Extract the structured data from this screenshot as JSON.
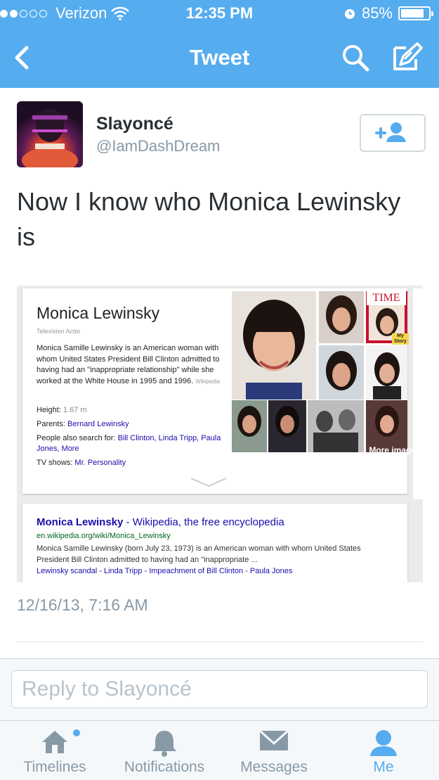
{
  "status_bar": {
    "carrier": "Verizon",
    "signal_bars": 2,
    "signal_max": 5,
    "time": "12:35 PM",
    "battery": "85%",
    "battery_level": 0.85
  },
  "nav": {
    "title": "Tweet"
  },
  "tweet": {
    "display_name": "Slayoncé",
    "handle": "@IamDashDream",
    "text": "Now I know who Monica Lewinsky is",
    "timestamp": "12/16/13, 7:16 AM"
  },
  "screenshot": {
    "knowledge_panel": {
      "title": "Monica Lewinsky",
      "subtitle": "Television Actor",
      "description": "Monica Samille Lewinsky is an American woman with whom United States President Bill Clinton admitted to having had an \"inappropriate relationship\" while she worked at the White House in 1995 and 1996.",
      "source": "Wikipedia",
      "height_label": "Height:",
      "height_value": "1.67 m",
      "parents_label": "Parents:",
      "parents_value": "Bernard Lewinsky",
      "people_label": "People also search for:",
      "people_value": "Bill Clinton, Linda Tripp, Paula Jones, More",
      "tv_label": "TV shows:",
      "tv_value": "Mr. Personality",
      "more_images": "More images",
      "magazine_title": "TIME",
      "magazine_cover_text": "My Story"
    },
    "search_result": {
      "title_name": "Monica Lewinsky",
      "title_rest": " - Wikipedia, the free encyclopedia",
      "url": "en.wikipedia.org/wiki/Monica_Lewinsky",
      "snippet": "Monica Samille Lewinsky (born July 23, 1973) is an American woman with whom United States President Bill Clinton admitted to having had an \"inappropriate ...",
      "links": "Lewinsky scandal - Linda Tripp - Impeachment of Bill Clinton - Paula Jones"
    }
  },
  "reply": {
    "placeholder": "Reply to Slayoncé"
  },
  "tabbar": {
    "items": [
      {
        "label": "Timelines",
        "active": false,
        "unread": true
      },
      {
        "label": "Notifications",
        "active": false,
        "unread": false
      },
      {
        "label": "Messages",
        "active": false,
        "unread": false
      },
      {
        "label": "Me",
        "active": true,
        "unread": false
      }
    ]
  },
  "colors": {
    "header_blue": "#55acee",
    "handle_gray": "#8899a6",
    "google_link": "#1a0dab",
    "google_url": "#006621"
  }
}
